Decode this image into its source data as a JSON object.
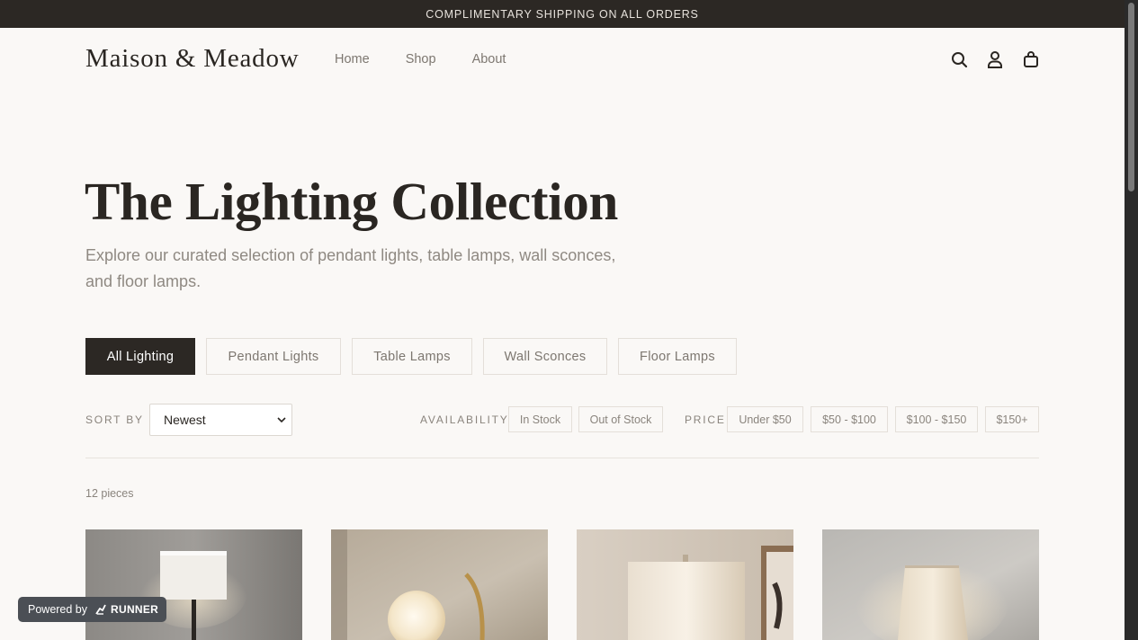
{
  "announcement": "COMPLIMENTARY SHIPPING ON ALL ORDERS",
  "header": {
    "brand": "Maison & Meadow",
    "nav": [
      "Home",
      "Shop",
      "About"
    ],
    "icons": [
      "search-icon",
      "account-icon",
      "bag-icon"
    ]
  },
  "hero": {
    "title": "The Lighting Collection",
    "subtitle": "Explore our curated selection of pendant lights, table lamps, wall sconces, and floor lamps."
  },
  "category_tabs": [
    {
      "label": "All Lighting",
      "active": true
    },
    {
      "label": "Pendant Lights",
      "active": false
    },
    {
      "label": "Table Lamps",
      "active": false
    },
    {
      "label": "Wall Sconces",
      "active": false
    },
    {
      "label": "Floor Lamps",
      "active": false
    }
  ],
  "filters": {
    "sort_label": "SORT BY",
    "sort_value": "Newest",
    "availability_label": "AVAILABILITY",
    "availability_options": [
      "In Stock",
      "Out of Stock"
    ],
    "price_label": "PRICE",
    "price_options": [
      "Under $50",
      "$50 - $100",
      "$100 - $150",
      "$150+"
    ]
  },
  "results_count": "12 pieces",
  "products": [
    {
      "image": "table-lamp-white-drum-shade"
    },
    {
      "image": "globe-lamp-brass-arc"
    },
    {
      "image": "lamp-cream-shade-framed-art"
    },
    {
      "image": "lamp-linen-tapered-shade"
    }
  ],
  "powered_by": {
    "prefix": "Powered by",
    "brand": "RUNNER"
  },
  "colors": {
    "announcement_bg": "#2c2824",
    "page_bg": "#faf8f6",
    "active_tab_bg": "#2c2824",
    "muted_text": "#8a847d"
  }
}
